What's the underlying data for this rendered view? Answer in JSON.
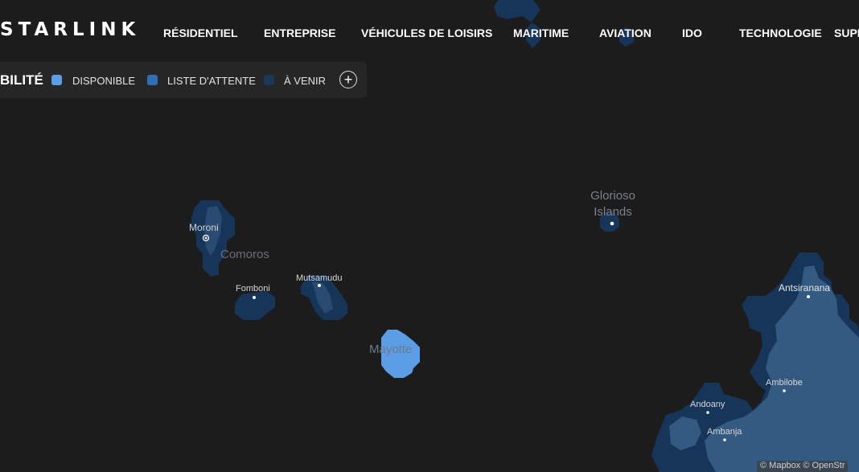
{
  "header": {
    "logo": "STARLINK",
    "nav": [
      {
        "label": "RÉSIDENTIEL"
      },
      {
        "label": "ENTREPRISE"
      },
      {
        "label": "VÉHICULES DE LOISIRS"
      },
      {
        "label": "MARITIME"
      },
      {
        "label": "AVIATION"
      },
      {
        "label": "IDO"
      },
      {
        "label": "TECHNOLOGIE"
      },
      {
        "label": "SUPP"
      }
    ]
  },
  "legend": {
    "title": "BILITÉ",
    "items": [
      {
        "label": "DISPONIBLE",
        "color": "#5b9ee6"
      },
      {
        "label": "LISTE D'ATTENTE",
        "color": "#2f6fb4"
      },
      {
        "label": "À VENIR",
        "color": "#1c3858"
      }
    ],
    "expand_symbol": "+"
  },
  "map": {
    "labels": {
      "moroni": "Moroni",
      "comoros": "Comoros",
      "fomboni": "Fomboni",
      "mutsamudu": "Mutsamudu",
      "mayotte": "Mayotte",
      "glorioso_line1": "Glorioso",
      "glorioso_line2": "Islands",
      "antsiranana": "Antsiranana",
      "ambilobe": "Ambilobe",
      "andoany": "Andoany",
      "ambanja": "Ambanja"
    },
    "attribution": "© Mapbox © OpenStr",
    "colors": {
      "background": "#1c1c1c",
      "land": "#3a5a7a",
      "available": "#5b9ee6",
      "waitlist": "#2f6fb4",
      "coming_soon": "#163559"
    }
  }
}
